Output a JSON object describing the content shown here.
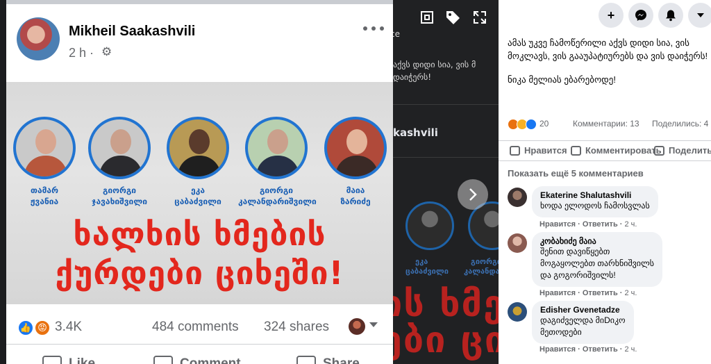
{
  "viewer": {
    "bg_fragments": [
      "ce",
      "აქვს დიდი სია, ვის მ",
      "დაიჭერს!"
    ],
    "bg_author": "kashvili",
    "bg_names": [
      "ეკა",
      "ცაბაძვილი",
      "გიორგი",
      "კალანდარიშვილი"
    ],
    "bg_slogan_1": "ის ხმე",
    "bg_slogan_2": "ები ციხ",
    "icons": [
      "tag-frame-icon",
      "tag-icon",
      "fullscreen-icon",
      "chevron-right-icon"
    ]
  },
  "post": {
    "author": "Mikheil Saakashvili",
    "time": "2 h ·",
    "image": {
      "people": [
        {
          "name": "თამარ\nჟვანია"
        },
        {
          "name": "გიორგი\nჯავახიშვილი"
        },
        {
          "name": "ეკა\nცაბაძვილი"
        },
        {
          "name": "გიორგი\nკალანდარიშვილი"
        },
        {
          "name": "მაია\nზარიძე"
        }
      ],
      "slogan_line1": "ხალხის ხმების",
      "slogan_line2": "ქურდები ციხეში!"
    },
    "reaction_count": "3.4K",
    "comments_count": "484 comments",
    "shares_count": "324 shares",
    "actions": {
      "like": "Like",
      "comment": "Comment",
      "share": "Share"
    }
  },
  "panel": {
    "top_buttons": [
      "+",
      "messenger",
      "bell",
      "caret"
    ],
    "text_lines": [
      "ამას უკვე ჩამოწერილი აქვს დიდი სია, ვის მოკლავს, ვის გააუპატიურებს და ვის დაიჭერს!",
      "ნიკა მელიას ებარებოდე!"
    ],
    "reactions_count": "20",
    "comments_label": "Комментарии: 13",
    "shares_label": "Поделились: 4",
    "actions": {
      "like": "Нравится",
      "comment": "Комментировать",
      "share": "Поделиться"
    },
    "more_comments": "Показать ещё 5 комментариев",
    "comments": [
      {
        "author": "Ekaterine Shalutashvili",
        "text": "ხოდა ელოდოს ჩამოსვლას",
        "like": "Нравится",
        "reply": "Ответить",
        "time": "2 ч."
      },
      {
        "author": "კობახიძე მაია",
        "text": "შენით დავიწყებთ\nმოგაყოლებთ თარხნიშვილს\nდა გოგორიშვილს!",
        "like": "Нравится",
        "reply": "Ответить",
        "time": "2 ч."
      },
      {
        "author": "Edisher Gvenetadze",
        "text": "დაგიძველდა მიDიკო\nმეთოდები",
        "like": "Нравится",
        "reply": "Ответить",
        "time": "2 ч."
      }
    ]
  }
}
